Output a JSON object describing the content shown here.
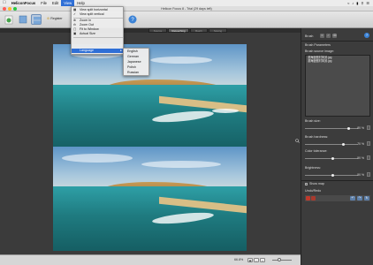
{
  "menubar": {
    "apple": "",
    "app_name": "HeliconFocus",
    "items": [
      "File",
      "Edit",
      "View",
      "Help"
    ],
    "active_item": "View",
    "right_icons": [
      "wifi-icon",
      "volume-icon",
      "battery-icon",
      "search-icon",
      "menu-icon"
    ]
  },
  "window": {
    "title": "Helicon Focus 8 - Trial (29 days left)"
  },
  "toolbar": {
    "register_label": "Register"
  },
  "tabs": [
    {
      "label": "Source"
    },
    {
      "label": "Retouching"
    },
    {
      "label": "Batch"
    },
    {
      "label": "Saving"
    }
  ],
  "view_menu": {
    "items": [
      {
        "label": "View split horizontal",
        "checked": false
      },
      {
        "label": "View split vertical",
        "checked": true
      },
      {
        "label": "Zoom In",
        "checked": false
      },
      {
        "label": "Zoom Out",
        "checked": false
      },
      {
        "label": "Fit to Window",
        "checked": false
      },
      {
        "label": "Actual Size",
        "checked": false
      },
      {
        "label": "Language",
        "checked": false,
        "submenu": true
      }
    ]
  },
  "language_menu": {
    "items": [
      "English",
      "German",
      "Japanese",
      "Polish",
      "Russian"
    ]
  },
  "status": {
    "zoom": "66.8%"
  },
  "panel": {
    "brush_label": "Brush",
    "brush_params_label": "Brush Parameters",
    "brush_source_label": "Brush source image:",
    "source_files": [
      "滨海度假村风景.jpg",
      "滨海度假村风景.jpg"
    ],
    "brush_size_label": "Brush size:",
    "brush_size_value": "80 %",
    "brush_hardness_label": "Brush hardness:",
    "brush_hardness_value": "70 %",
    "color_tolerance_label": "Color tolerance:",
    "color_tolerance_value": "50 %",
    "brightness_label": "Brightness:",
    "brightness_value": "50 %",
    "show_map_label": "Show map",
    "undo_redo_label": "Undo/Redo"
  },
  "colors": {
    "menu_highlight": "#2f6fd6",
    "panel_bg": "#3c3c3c",
    "canvas_bg": "#3b3b3b"
  }
}
